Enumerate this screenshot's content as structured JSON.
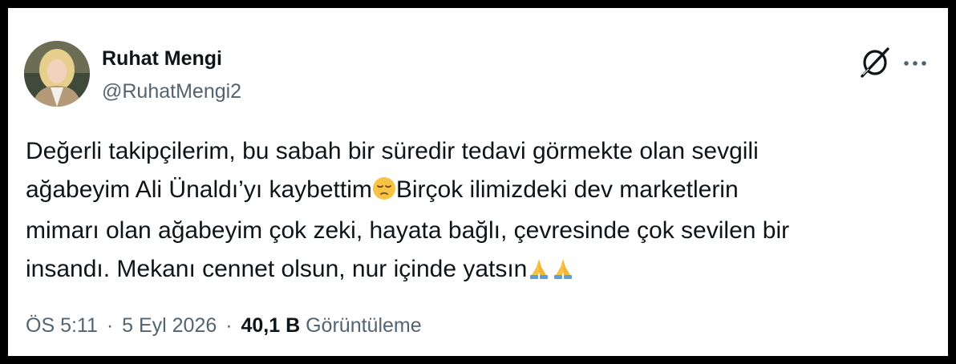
{
  "author": {
    "name": "Ruhat Mengi",
    "handle": "@RuhatMengi2"
  },
  "icons": {
    "grok": "grok-icon",
    "more": "more-icon",
    "sad_emoji": "pensive-face-emoji",
    "pray_emoji": "folded-hands-emoji"
  },
  "tweet": {
    "line1": "Değerli takipçilerim, bu sabah bir süredir tedavi görmekte olan sevgili",
    "line2_before_emoji": "ağabeyim Ali Ünaldı’yı kaybettim",
    "line2_after_emoji": "Birçok ilimizdeki dev marketlerin",
    "line3": "mimarı olan ağabeyim çok zeki, hayata bağlı, çevresinde çok sevilen bir",
    "line4": "insandı. Mekanı cennet olsun, nur  içinde yatsın"
  },
  "meta": {
    "time": "ÖS 5:11",
    "date": "5 Eyl 2026",
    "separator": "·",
    "views_count": "40,1 B",
    "views_label": "Görüntüleme"
  },
  "colors": {
    "frame": "#000000",
    "background": "#ffffff",
    "text_primary": "#0f1419",
    "text_secondary": "#536471",
    "emoji_yellow": "#f6c344"
  }
}
